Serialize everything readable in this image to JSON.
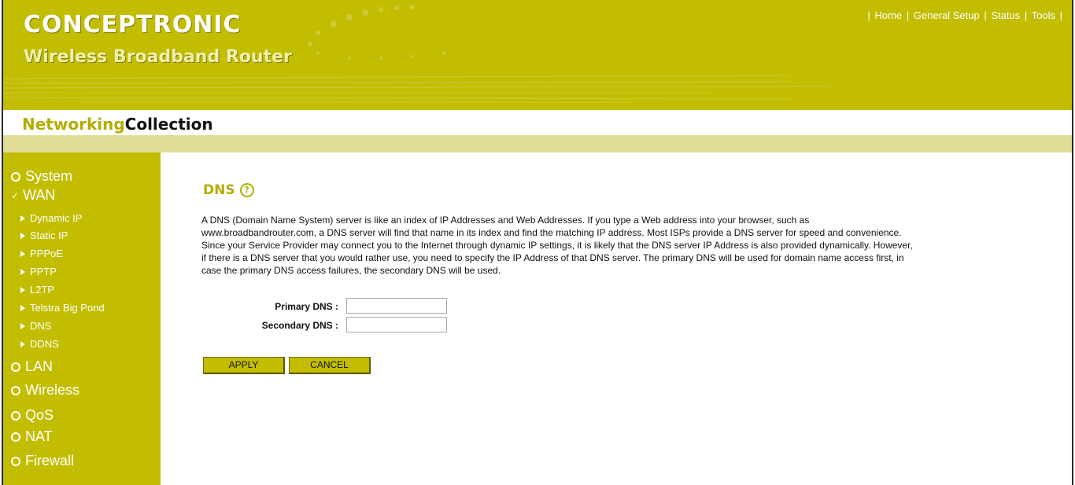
{
  "header": {
    "brand": "CONCEPTRONIC",
    "product": "Wireless Broadband Router",
    "topnav": [
      "Home",
      "General Setup",
      "Status",
      "Tools"
    ]
  },
  "collection": {
    "part1": "Networking",
    "part2": "Collection"
  },
  "sidebar": {
    "items": [
      {
        "label": "System",
        "type": "main"
      },
      {
        "label": "WAN",
        "type": "main",
        "expanded": true
      },
      {
        "label": "Dynamic IP",
        "type": "sub"
      },
      {
        "label": "Static IP",
        "type": "sub"
      },
      {
        "label": "PPPoE",
        "type": "sub"
      },
      {
        "label": "PPTP",
        "type": "sub"
      },
      {
        "label": "L2TP",
        "type": "sub"
      },
      {
        "label": "Telstra Big Pond",
        "type": "sub"
      },
      {
        "label": "DNS",
        "type": "sub"
      },
      {
        "label": "DDNS",
        "type": "sub"
      },
      {
        "label": "LAN",
        "type": "main"
      },
      {
        "label": "Wireless",
        "type": "main"
      },
      {
        "label": "QoS",
        "type": "main"
      },
      {
        "label": "NAT",
        "type": "main"
      },
      {
        "label": "Firewall",
        "type": "main"
      }
    ]
  },
  "main": {
    "title": "DNS",
    "description_lines": [
      "A DNS (Domain Name System) server is like an index of IP Addresses and Web Addresses. If you type a Web address into your browser, such as",
      "www.broadbandrouter.com, a DNS server will find that name in its index and find the matching IP address. Most ISPs provide a DNS server for speed and convenience.",
      "Since your Service Provider may connect you to the Internet through dynamic IP settings, it is likely that the DNS server IP Address is also provided dynamically. However,",
      "if there is a DNS server that you would rather use, you need to specify the IP Address of that DNS server. The primary DNS will be used for domain name access first, in",
      "case the primary DNS access failures, the secondary DNS will be used."
    ],
    "primary_dns_label": "Primary DNS :",
    "primary_dns_value": "",
    "secondary_dns_label": "Secondary DNS :",
    "secondary_dns_value": "",
    "apply_label": "APPLY",
    "cancel_label": "CANCEL"
  },
  "colors": {
    "olive": "#c2bd00",
    "olive_text": "#b3ad00",
    "light_bar": "#e2dd96"
  },
  "icons": {
    "help": "help-circle-icon",
    "main_bullet": "circle-bullet-icon",
    "sub_bullet": "triangle-right-icon",
    "expanded": "check-icon"
  }
}
